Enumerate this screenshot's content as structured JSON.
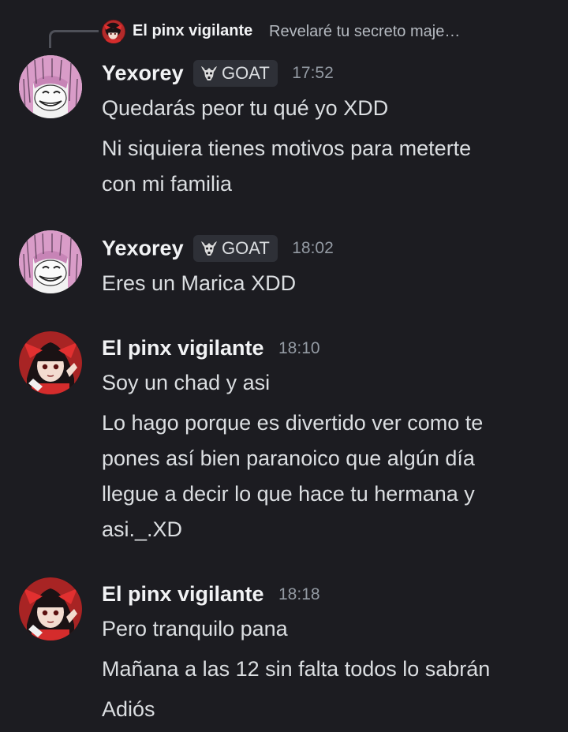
{
  "reply": {
    "author": "El pinx vigilante",
    "text": "Revelaré tu secreto maje…"
  },
  "messages": [
    {
      "author": "Yexorey",
      "tag": "GOAT",
      "time": "17:52",
      "lines": [
        "Quedarás peor tu qué yo XDD",
        "Ni siquiera tienes motivos para meterte",
        "con mi familia"
      ]
    },
    {
      "author": "Yexorey",
      "tag": "GOAT",
      "time": "18:02",
      "lines": [
        "Eres un Marica XDD"
      ]
    },
    {
      "author": "El pinx vigilante",
      "time": "18:10",
      "lines": [
        "Soy un chad y asi",
        "Lo hago porque es divertido ver como te",
        "pones así bien paranoico que algún día",
        "llegue a decir lo que hace tu hermana y",
        "asi._.XD"
      ]
    },
    {
      "author": "El pinx vigilante",
      "time": "18:18",
      "lines": [
        "Pero tranquilo pana",
        "Mañana a las 12 sin falta todos lo sabrán",
        "Adiós"
      ]
    }
  ],
  "icons": {
    "tag": "goat-icon",
    "avatar_yexorey": "pink-hair-avatar",
    "avatar_pinx": "shrine-maiden-avatar"
  },
  "colors": {
    "background": "#1c1c21",
    "author": "#f2f3f5",
    "text": "#dbdee1",
    "muted": "#949ba4",
    "tag_bg": "#2e3037"
  }
}
